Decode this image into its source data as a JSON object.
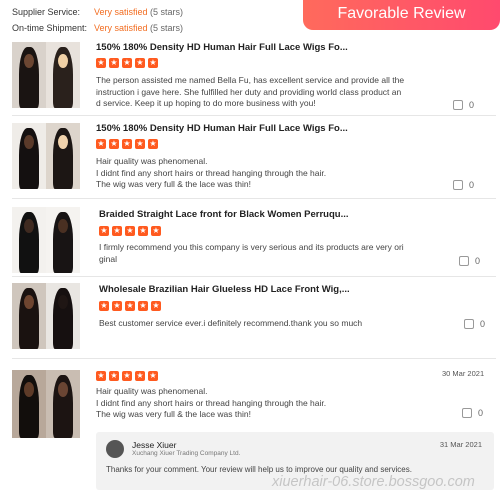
{
  "header": {
    "ratings": [
      {
        "label": "Supplier Service:",
        "value": "Very satisfied",
        "count": "(5 stars)"
      },
      {
        "label": "On-time Shipment:",
        "value": "Very satisfied",
        "count": "(5 stars)"
      }
    ],
    "banner": "Favorable Review"
  },
  "colors": {
    "accent": "#f26d21",
    "banner_gradient": [
      "#ff6a5c",
      "#ff4a6e"
    ],
    "star": "#ff5a1f"
  },
  "reviews": [
    {
      "title": "150% 180% Density HD Human Hair Full Lace Wigs Fo...",
      "rating": 5,
      "lines": [
        "The person assisted me named Bella Fu, has excellent service and provide all the",
        "instruction i gave here. She fulfilled her duty and providing world class product an",
        "d service. Keep it up hoping to do more business with you!"
      ],
      "likes": "0"
    },
    {
      "title": "150% 180% Density HD Human Hair Full Lace Wigs Fo...",
      "rating": 5,
      "lines": [
        "Hair quality was phenomenal.",
        "I didnt find any short hairs or thread hanging through the hair.",
        "The wig was very full & the lace was thin!"
      ],
      "likes": "0"
    },
    {
      "title": "Braided Straight Lace front for Black Women Perruqu...",
      "rating": 5,
      "lines": [
        "I firmly recommend you this company is very serious and its products are very ori",
        "ginal"
      ],
      "likes": "0"
    },
    {
      "title": "Wholesale Brazilian Hair Glueless HD Lace Front Wig,...",
      "rating": 5,
      "lines": [
        "Best customer service ever.i definitely recommend.thank you so much"
      ],
      "likes": "0"
    },
    {
      "title": "",
      "rating": 5,
      "date": "30 Mar 2021",
      "lines": [
        "Hair quality was phenomenal.",
        "I didnt find any short hairs or thread hanging through the hair.",
        "The wig was very full & the lace was thin!"
      ],
      "likes": "0"
    }
  ],
  "reply": {
    "name": "Jesse Xiuer",
    "company": "Xuchang Xiuer Trading Company Ltd.",
    "date": "31 Mar 2021",
    "text": "Thanks for your comment. Your review will help us to improve our quality and services."
  },
  "watermark": "xiuerhair-06.store.bossgoo.com"
}
